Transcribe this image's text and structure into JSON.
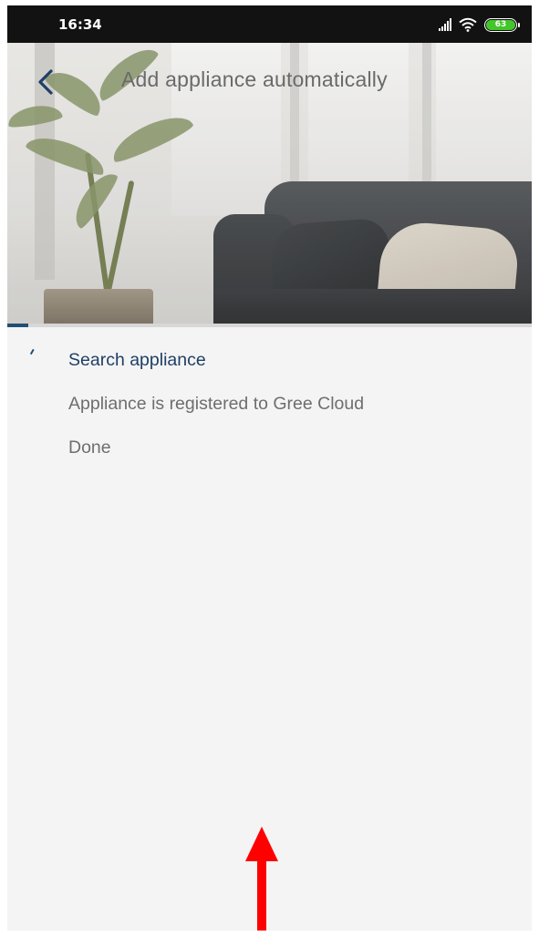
{
  "status_bar": {
    "time": "16:34",
    "battery_level": "63",
    "signal_icon": "signal-bars-icon",
    "wifi_icon": "wifi-icon"
  },
  "header": {
    "back_icon": "chevron-left-icon",
    "title": "Add appliance automatically"
  },
  "progress": {
    "fraction": 0.04,
    "color": "#1f4e79"
  },
  "steps": [
    {
      "label": "Search appliance",
      "active": true
    },
    {
      "label": "Appliance is registered to Gree Cloud",
      "active": false
    },
    {
      "label": "Done",
      "active": false
    }
  ],
  "annotation": {
    "icon": "red-up-arrow-icon",
    "color": "#ff0000"
  }
}
